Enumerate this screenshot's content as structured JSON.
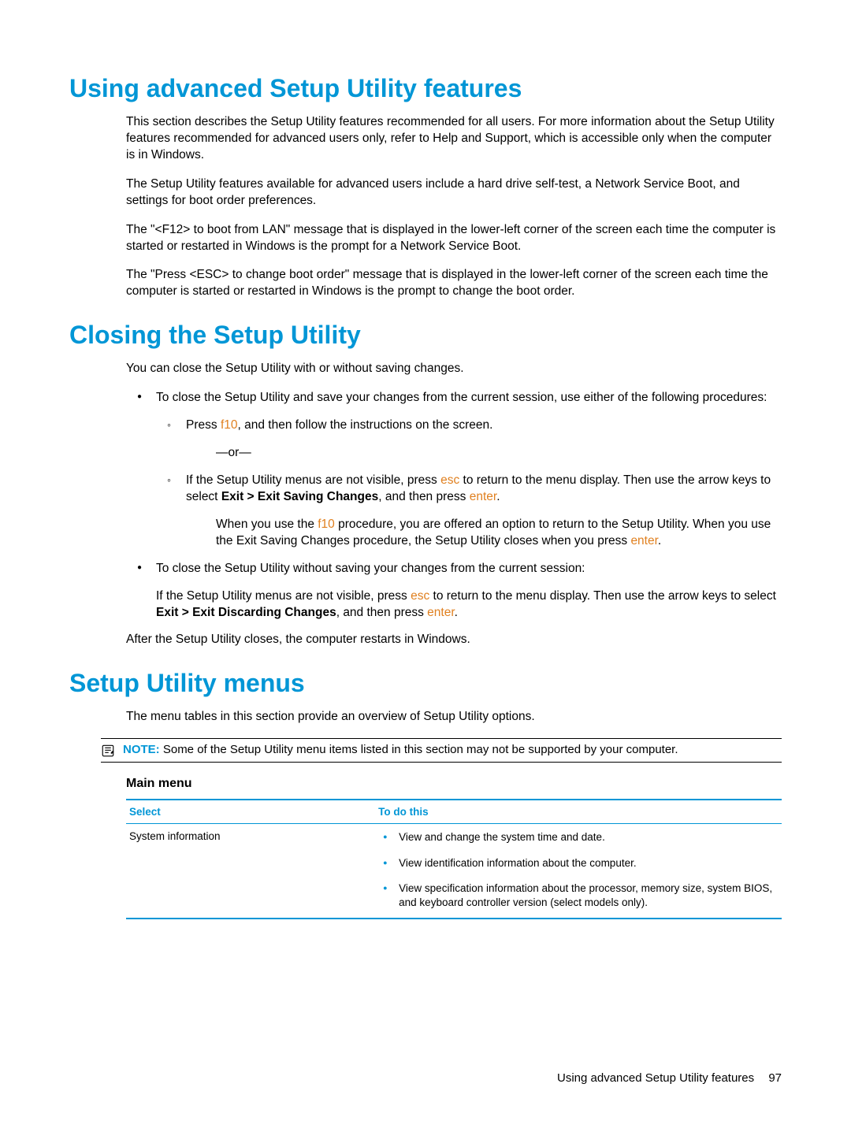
{
  "section1": {
    "heading": "Using advanced Setup Utility features",
    "p1": "This section describes the Setup Utility features recommended for all users. For more information about the Setup Utility features recommended for advanced users only, refer to Help and Support, which is accessible only when the computer is in Windows.",
    "p2": "The Setup Utility features available for advanced users include a hard drive self-test, a Network Service Boot, and settings for boot order preferences.",
    "p3": "The \"<F12> to boot from LAN\" message that is displayed in the lower-left corner of the screen each time the computer is started or restarted in Windows is the prompt for a Network Service Boot.",
    "p4": "The \"Press <ESC> to change boot order\" message that is displayed in the lower-left corner of the screen each time the computer is started or restarted in Windows is the prompt to change the boot order."
  },
  "section2": {
    "heading": "Closing the Setup Utility",
    "intro": "You can close the Setup Utility with or without saving changes.",
    "b1_lead": "To close the Setup Utility and save your changes from the current session, use either of the following procedures:",
    "s1_a": "Press ",
    "s1_key": "f10",
    "s1_b": ", and then follow the instructions on the screen.",
    "or": "—or—",
    "s2_a": "If the Setup Utility menus are not visible, press ",
    "s2_key1": "esc",
    "s2_b": " to return to the menu display. Then use the arrow keys to select ",
    "s2_bold": "Exit > Exit Saving Changes",
    "s2_c": ", and then press ",
    "s2_key2": "enter",
    "s2_d": ".",
    "s2_p2_a": "When you use the ",
    "s2_p2_key": "f10",
    "s2_p2_b": " procedure, you are offered an option to return to the Setup Utility. When you use the Exit Saving Changes procedure, the Setup Utility closes when you press ",
    "s2_p2_key2": "enter",
    "s2_p2_c": ".",
    "b2_lead": "To close the Setup Utility without saving your changes from the current session:",
    "b2_a": "If the Setup Utility menus are not visible, press ",
    "b2_key1": "esc",
    "b2_b": " to return to the menu display. Then use the arrow keys to select ",
    "b2_bold": "Exit > Exit Discarding Changes",
    "b2_c": ", and then press ",
    "b2_key2": "enter",
    "b2_d": ".",
    "after": "After the Setup Utility closes, the computer restarts in Windows."
  },
  "section3": {
    "heading": "Setup Utility menus",
    "intro": "The menu tables in this section provide an overview of Setup Utility options.",
    "note_label": "NOTE:",
    "note_text": "Some of the Setup Utility menu items listed in this section may not be supported by your computer.",
    "subhead": "Main menu",
    "th1": "Select",
    "th2": "To do this",
    "row_select": "System information",
    "row_items": [
      "View and change the system time and date.",
      "View identification information about the computer.",
      "View specification information about the processor, memory size, system BIOS, and keyboard controller version (select models only)."
    ]
  },
  "footer": {
    "text": "Using advanced Setup Utility features",
    "page": "97"
  }
}
